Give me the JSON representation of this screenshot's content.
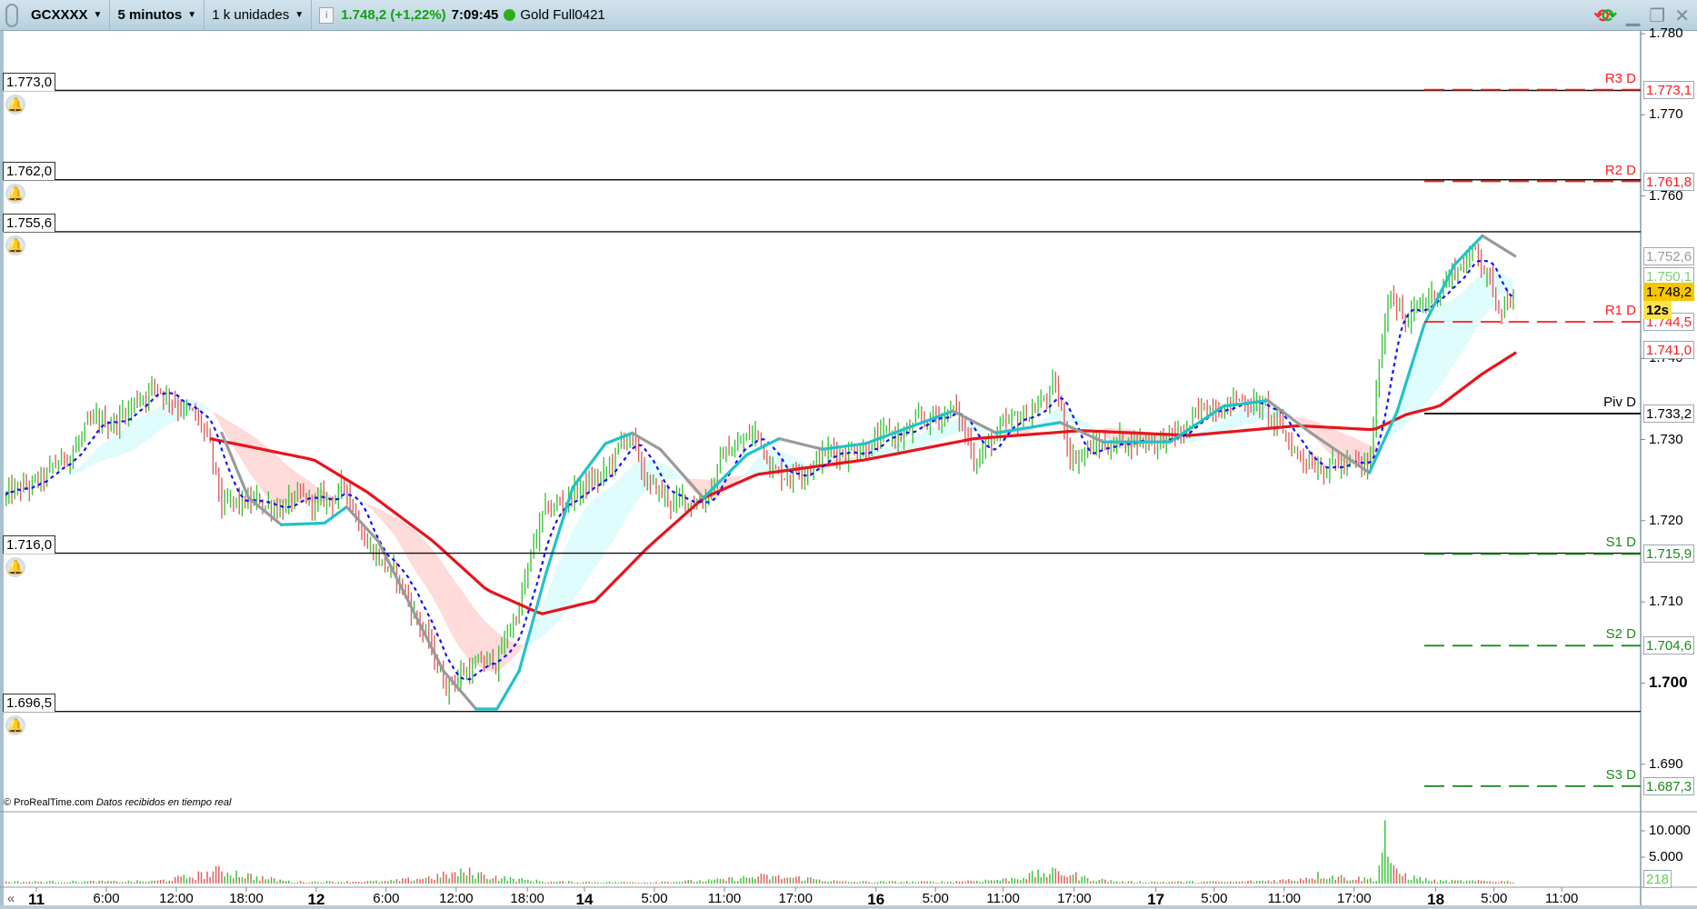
{
  "toolbar": {
    "instrument": "GCXXXX",
    "timeframe": "5 minutos",
    "units": "1 k unidades",
    "last_price": "1.748,2 (+1,22%)",
    "time": "7:09:45",
    "contract": "Gold Full0421",
    "status_color": "#2fae1a"
  },
  "alert_levels": [
    {
      "label": "1.773,0",
      "value": 1773.0
    },
    {
      "label": "1.762,0",
      "value": 1762.0
    },
    {
      "label": "1.755,6",
      "value": 1755.6
    },
    {
      "label": "1.716,0",
      "value": 1716.0
    },
    {
      "label": "1.696,5",
      "value": 1696.5
    }
  ],
  "pivots": [
    {
      "name": "R3 D",
      "label": "1.773,1",
      "value": 1773.1,
      "color": "#ff1a1a",
      "style": "dashed"
    },
    {
      "name": "R2 D",
      "label": "1.761,8",
      "value": 1761.8,
      "color": "#ff1a1a",
      "style": "dashed"
    },
    {
      "name": "R1 D",
      "label": "1.744,5",
      "value": 1744.5,
      "color": "#ff1a1a",
      "style": "dashed"
    },
    {
      "name": "Piv D",
      "label": "1.733,2",
      "value": 1733.2,
      "color": "#000000",
      "style": "solid"
    },
    {
      "name": "S1 D",
      "label": "1.715,9",
      "value": 1715.9,
      "color": "#1a8a1a",
      "style": "dashed"
    },
    {
      "name": "S2 D",
      "label": "1.704,6",
      "value": 1704.6,
      "color": "#1a8a1a",
      "style": "dashed"
    },
    {
      "name": "S3 D",
      "label": "1.687,3",
      "value": 1687.3,
      "color": "#1a8a1a",
      "style": "dashed"
    }
  ],
  "axis_markers": {
    "fast_ma": {
      "label": "1.752,6",
      "value": 1752.6,
      "color": "#999999"
    },
    "cloud": {
      "label": "1.750,1",
      "value": 1750.1,
      "color": "#7fcf7f"
    },
    "current": {
      "label": "1.748,2",
      "value": 1748.2,
      "color": "#f7c600"
    },
    "countdown": "12s",
    "slow_ma": {
      "label": "1.741,0",
      "value": 1741.0,
      "color": "#ff1a1a"
    }
  },
  "credit": {
    "brand": "© ProRealTime.com",
    "note": "Datos recibidos en tiempo real"
  },
  "chart_data": {
    "type": "candlestick",
    "title": "GCXXXX 5 minutos",
    "x_unit": "hours from day 11 00:00 (trading time)",
    "price_axis": {
      "ylim": [
        1684,
        1784
      ],
      "ticks": [
        {
          "value": 1780,
          "label": "1.780"
        },
        {
          "value": 1770,
          "label": "1.770"
        },
        {
          "value": 1760,
          "label": "1.760"
        },
        {
          "value": 1740,
          "label": "1.740"
        },
        {
          "value": 1730,
          "label": "1.730"
        },
        {
          "value": 1720,
          "label": "1.720"
        },
        {
          "value": 1710,
          "label": "1.710"
        },
        {
          "value": 1700,
          "label": "1.700",
          "bold": true
        },
        {
          "value": 1690,
          "label": "1.690"
        }
      ]
    },
    "time_axis": [
      {
        "h": 0,
        "label": "11",
        "day": true
      },
      {
        "h": 6,
        "label": "6:00"
      },
      {
        "h": 12,
        "label": "12:00"
      },
      {
        "h": 18,
        "label": "18:00"
      },
      {
        "h": 24,
        "label": "12",
        "day": true
      },
      {
        "h": 30,
        "label": "6:00"
      },
      {
        "h": 36,
        "label": "12:00"
      },
      {
        "h": 42.1,
        "label": "18:00"
      },
      {
        "h": 47,
        "label": "14",
        "day": true
      },
      {
        "h": 53,
        "label": "5:00"
      },
      {
        "h": 59,
        "label": "11:00"
      },
      {
        "h": 65.1,
        "label": "17:00"
      },
      {
        "h": 72,
        "label": "16",
        "day": true
      },
      {
        "h": 77.1,
        "label": "5:00"
      },
      {
        "h": 82.9,
        "label": "11:00"
      },
      {
        "h": 89,
        "label": "17:00"
      },
      {
        "h": 96,
        "label": "17",
        "day": true
      },
      {
        "h": 101,
        "label": "5:00"
      },
      {
        "h": 107,
        "label": "11:00"
      },
      {
        "h": 113,
        "label": "17:00"
      },
      {
        "h": 120,
        "label": "18",
        "day": true
      },
      {
        "h": 125,
        "label": "5:00"
      },
      {
        "h": 130.8,
        "label": "11:00"
      }
    ],
    "close_path": [
      [
        -2.6,
        1722.8
      ],
      [
        0.6,
        1724.8
      ],
      [
        4.3,
        1730.8
      ],
      [
        7.1,
        1732.8
      ],
      [
        9.9,
        1736.8
      ],
      [
        12.2,
        1734.8
      ],
      [
        14.5,
        1730.8
      ],
      [
        15.9,
        1721.5
      ],
      [
        19.1,
        1722.1
      ],
      [
        24.7,
        1722.1
      ],
      [
        26.6,
        1724.1
      ],
      [
        28.4,
        1717.5
      ],
      [
        31.2,
        1712.1
      ],
      [
        33.1,
        1706.8
      ],
      [
        34.9,
        1700.1
      ],
      [
        36.8,
        1701.5
      ],
      [
        39.5,
        1702.8
      ],
      [
        41.4,
        1709.5
      ],
      [
        43.3,
        1720.1
      ],
      [
        46.0,
        1723.5
      ],
      [
        48.8,
        1725.5
      ],
      [
        50.7,
        1730.8
      ],
      [
        52.5,
        1724.1
      ],
      [
        54.9,
        1722.1
      ],
      [
        57.2,
        1722.8
      ],
      [
        59.0,
        1728.1
      ],
      [
        61.8,
        1730.8
      ],
      [
        63.7,
        1725.5
      ],
      [
        67.4,
        1728.1
      ],
      [
        71.1,
        1729.5
      ],
      [
        74.8,
        1730.8
      ],
      [
        78.6,
        1734.1
      ],
      [
        80.4,
        1728.1
      ],
      [
        84.1,
        1732.1
      ],
      [
        87.4,
        1736.1
      ],
      [
        88.7,
        1728.1
      ],
      [
        93.4,
        1730.1
      ],
      [
        98.0,
        1730.1
      ],
      [
        100.9,
        1734.8
      ],
      [
        104.6,
        1734.8
      ],
      [
        108.3,
        1728.1
      ],
      [
        111.9,
        1726.8
      ],
      [
        114.3,
        1726.1
      ],
      [
        115.2,
        1740.1
      ],
      [
        116.1,
        1749.5
      ],
      [
        117.5,
        1744.1
      ],
      [
        119.4,
        1747.5
      ],
      [
        121.6,
        1750.8
      ],
      [
        123.6,
        1753.5
      ],
      [
        125.3,
        1746.8
      ],
      [
        126.8,
        1748.2
      ]
    ],
    "slow_ma": {
      "name": "Slow MA",
      "color": "#e8141c",
      "points": [
        [
          14.9,
          1730.1
        ],
        [
          23.8,
          1727.5
        ],
        [
          28.4,
          1723.5
        ],
        [
          34.0,
          1717.5
        ],
        [
          38.6,
          1711.5
        ],
        [
          43.3,
          1708.5
        ],
        [
          47.9,
          1710.1
        ],
        [
          52.5,
          1716.8
        ],
        [
          57.2,
          1722.8
        ],
        [
          61.8,
          1725.7
        ],
        [
          71.1,
          1727.5
        ],
        [
          80.4,
          1730.1
        ],
        [
          89.6,
          1731.1
        ],
        [
          98.9,
          1730.5
        ],
        [
          108.2,
          1731.7
        ],
        [
          114.7,
          1731.2
        ],
        [
          117.5,
          1733.1
        ],
        [
          120.3,
          1734.1
        ],
        [
          124.0,
          1738.1
        ],
        [
          127.2,
          1741.0
        ]
      ]
    },
    "fast_ma": {
      "name": "Fast MA",
      "up_color": "#1ec3c8",
      "down_color": "#9a9a9a",
      "points": [
        [
          15.9,
          1730.8
        ],
        [
          18.2,
          1722.8
        ],
        [
          21.0,
          1719.5
        ],
        [
          24.7,
          1719.7
        ],
        [
          26.6,
          1721.7
        ],
        [
          29.3,
          1717.5
        ],
        [
          32.1,
          1709.5
        ],
        [
          34.9,
          1701.5
        ],
        [
          37.7,
          1696.8
        ],
        [
          39.5,
          1696.8
        ],
        [
          41.4,
          1701.5
        ],
        [
          43.7,
          1713.5
        ],
        [
          46.0,
          1724.1
        ],
        [
          48.8,
          1729.5
        ],
        [
          51.1,
          1730.8
        ],
        [
          53.5,
          1728.8
        ],
        [
          57.2,
          1722.8
        ],
        [
          60.9,
          1728.1
        ],
        [
          63.7,
          1730.1
        ],
        [
          67.4,
          1728.8
        ],
        [
          71.1,
          1729.5
        ],
        [
          78.6,
          1733.5
        ],
        [
          82.3,
          1730.8
        ],
        [
          87.8,
          1732.1
        ],
        [
          91.5,
          1729.7
        ],
        [
          97.2,
          1729.7
        ],
        [
          101.8,
          1734.1
        ],
        [
          105.6,
          1734.8
        ],
        [
          109.3,
          1730.8
        ],
        [
          114.3,
          1725.9
        ],
        [
          116.7,
          1733.5
        ],
        [
          119.0,
          1744.1
        ],
        [
          121.6,
          1751.5
        ],
        [
          124.0,
          1755.1
        ],
        [
          126.8,
          1752.6
        ]
      ]
    },
    "signal_line": {
      "name": "Dotted MA",
      "color": "#1414f0"
    },
    "volume": {
      "ticks": [
        {
          "value": 10000,
          "label": "10.000"
        },
        {
          "value": 5000,
          "label": "5.000"
        }
      ],
      "last": "218",
      "profile": [
        [
          -3,
          400
        ],
        [
          10,
          500
        ],
        [
          13,
          1500
        ],
        [
          16,
          3000
        ],
        [
          19,
          1400
        ],
        [
          22,
          400
        ],
        [
          30,
          500
        ],
        [
          33,
          1200
        ],
        [
          37,
          2600
        ],
        [
          40,
          1200
        ],
        [
          44,
          400
        ],
        [
          52,
          300
        ],
        [
          58,
          700
        ],
        [
          62,
          1600
        ],
        [
          66,
          1200
        ],
        [
          69,
          400
        ],
        [
          78,
          400
        ],
        [
          83,
          900
        ],
        [
          86,
          2200
        ],
        [
          88,
          2600
        ],
        [
          90,
          1200
        ],
        [
          93,
          400
        ],
        [
          103,
          400
        ],
        [
          108,
          900
        ],
        [
          110,
          2000
        ],
        [
          113,
          1200
        ],
        [
          115,
          1000
        ],
        [
          115.6,
          12000
        ],
        [
          116.2,
          3000
        ],
        [
          118,
          1400
        ],
        [
          120,
          600
        ],
        [
          127,
          500
        ]
      ]
    }
  }
}
